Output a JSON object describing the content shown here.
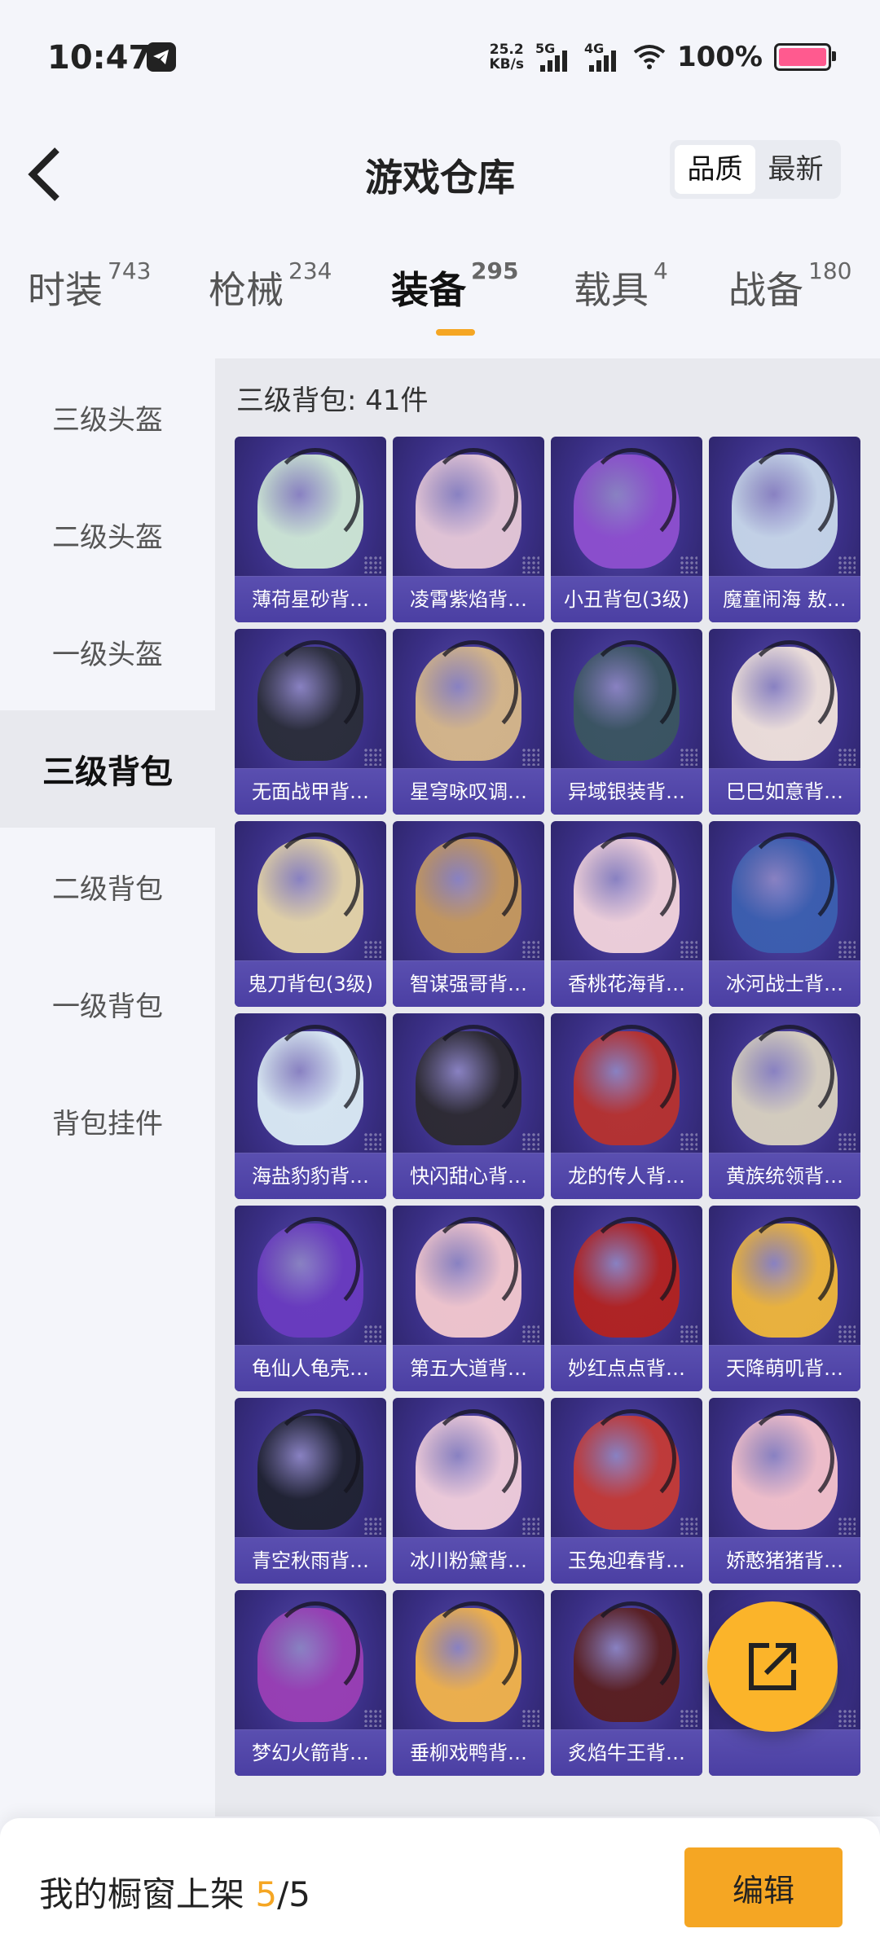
{
  "status_bar": {
    "time": "10:47",
    "net_speed_value": "25.2",
    "net_speed_unit": "KB/s",
    "signal_1": "5G",
    "signal_2": "4G",
    "battery": "100%",
    "battery_color": "#ff5a8f"
  },
  "header": {
    "title": "游戏仓库",
    "sort_options": [
      "品质",
      "最新"
    ],
    "sort_active": "品质"
  },
  "tabs": [
    {
      "label": "时装",
      "count": "743"
    },
    {
      "label": "枪械",
      "count": "234"
    },
    {
      "label": "装备",
      "count": "295",
      "active": true
    },
    {
      "label": "载具",
      "count": "4"
    },
    {
      "label": "战备",
      "count": "180"
    }
  ],
  "sidebar": {
    "items": [
      "三级头盔",
      "二级头盔",
      "一级头盔",
      "三级背包",
      "二级背包",
      "一级背包",
      "背包挂件"
    ],
    "active": "三级背包"
  },
  "content": {
    "section_title": "三级背包: 41件",
    "items": [
      {
        "name": "薄荷星砂背…",
        "color": "#cfe9d6"
      },
      {
        "name": "凌霄紫焰背…",
        "color": "#e7c9d8"
      },
      {
        "name": "小丑背包(3级)",
        "color": "#8e4fcf"
      },
      {
        "name": "魔童闹海 敖…",
        "color": "#c8d8ea"
      },
      {
        "name": "无面战甲背…",
        "color": "#2a2d38"
      },
      {
        "name": "星穹咏叹调…",
        "color": "#d8b98a"
      },
      {
        "name": "异域银装背…",
        "color": "#3a5560"
      },
      {
        "name": "巳巳如意背…",
        "color": "#f1e3dc"
      },
      {
        "name": "鬼刀背包(3级)",
        "color": "#e6d6a8"
      },
      {
        "name": "智谋强哥背…",
        "color": "#c79a5d"
      },
      {
        "name": "香桃花海背…",
        "color": "#f3d4dc"
      },
      {
        "name": "冰河战士背…",
        "color": "#3b5fb0"
      },
      {
        "name": "海盐豹豹背…",
        "color": "#dcecf5"
      },
      {
        "name": "快闪甜心背…",
        "color": "#2c2a30"
      },
      {
        "name": "龙的传人背…",
        "color": "#b8322e"
      },
      {
        "name": "黄族统领背…",
        "color": "#d9d2c0"
      },
      {
        "name": "龟仙人龟壳…",
        "color": "#6a3bc0"
      },
      {
        "name": "第五大道背…",
        "color": "#f4c9cf"
      },
      {
        "name": "妙红点点背…",
        "color": "#b3221f"
      },
      {
        "name": "天降萌叽背…",
        "color": "#f0b73a"
      },
      {
        "name": "青空秋雨背…",
        "color": "#1f2230"
      },
      {
        "name": "冰川粉黛背…",
        "color": "#f2cfdc"
      },
      {
        "name": "玉兔迎春背…",
        "color": "#c53a35"
      },
      {
        "name": "娇憨猪猪背…",
        "color": "#f5c3cc"
      },
      {
        "name": "梦幻火箭背…",
        "color": "#9a3fb5"
      },
      {
        "name": "垂柳戏鸭背…",
        "color": "#f3b44a"
      },
      {
        "name": "炙焰牛王背…",
        "color": "#5a1e1e"
      },
      {
        "name": "",
        "color": "#6b6f78"
      }
    ]
  },
  "bottom_bar": {
    "shelf_label": "我的橱窗上架",
    "shelf_current": "5",
    "shelf_total": "/5",
    "edit_label": "编辑"
  }
}
